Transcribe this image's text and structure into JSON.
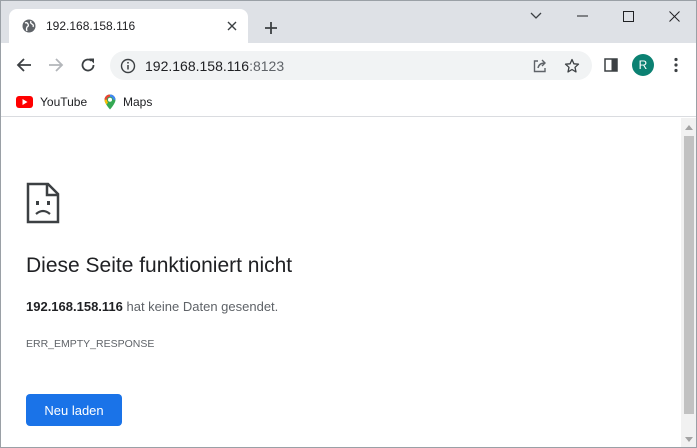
{
  "tab": {
    "title": "192.168.158.116",
    "favicon": "globe-icon"
  },
  "window_controls": {
    "icons": [
      "chevron-down-icon",
      "minimize-icon",
      "maximize-icon",
      "close-icon"
    ]
  },
  "toolbar": {
    "url_host": "192.168.158.116",
    "url_port": ":8123",
    "avatar_letter": "R",
    "avatar_color": "#0b8172"
  },
  "bookmarks": [
    {
      "label": "YouTube",
      "icon": "youtube-icon"
    },
    {
      "label": "Maps",
      "icon": "maps-icon"
    }
  ],
  "error_page": {
    "heading": "Diese Seite funktioniert nicht",
    "host": "192.168.158.116",
    "description_suffix": " hat keine Daten gesendet.",
    "error_code": "ERR_EMPTY_RESPONSE",
    "reload_label": "Neu laden",
    "button_color": "#1a73e8"
  }
}
